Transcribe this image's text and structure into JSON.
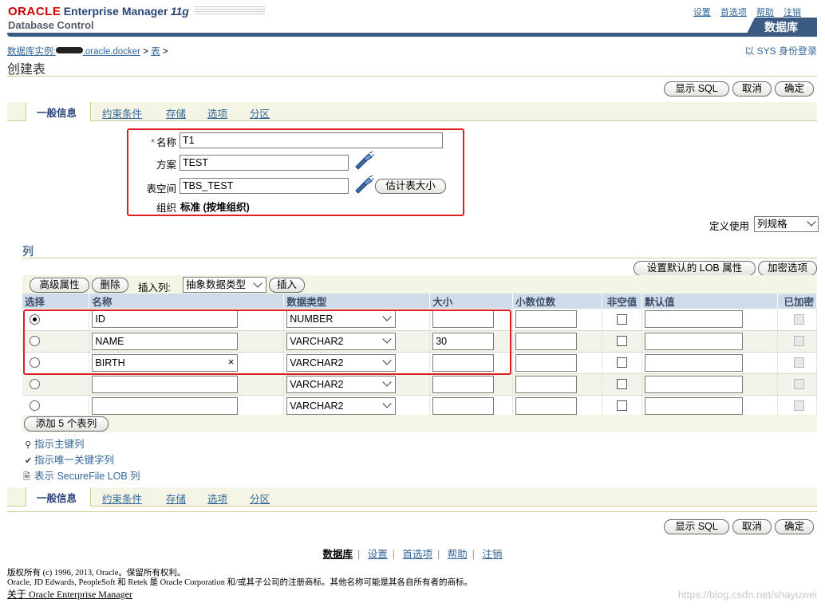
{
  "header": {
    "brand_oracle": "ORACLE",
    "brand_product": "Enterprise Manager",
    "brand_version": "11g",
    "brand_sub": "Database Control",
    "global_links": [
      "设置",
      "首选项",
      "帮助",
      "注销"
    ],
    "active_tab": "数据库"
  },
  "breadcrumb": {
    "instance_prefix": "数据库实例:",
    "instance_suffix": ".oracle.docker",
    "sep": ">",
    "table": "表",
    "tail": ">"
  },
  "login_info": "以 SYS 身份登录",
  "page_title": "创建表",
  "actions": {
    "show_sql": "显示 SQL",
    "cancel": "取消",
    "ok": "确定"
  },
  "subtabs": [
    "一般信息",
    "约束条件",
    "存储",
    "选项",
    "分区"
  ],
  "form": {
    "required_mark": "*",
    "name_label": "名称",
    "name_value": "T1",
    "schema_label": "方案",
    "schema_value": "TEST",
    "tablespace_label": "表空间",
    "tablespace_value": "TBS_TEST",
    "estimate_button": "估计表大小",
    "org_label": "组织",
    "org_value": "标准 (按堆组织)",
    "define_using_label": "定义使用",
    "define_using_value": "列规格"
  },
  "columns_section": {
    "title": "列",
    "lob_button": "设置默认的 LOB 属性",
    "encrypt_button": "加密选项",
    "advanced_button": "高级属性",
    "delete_button": "删除",
    "insert_label": "插入列:",
    "insert_type": "抽象数据类型",
    "insert_button": "插入",
    "headers": [
      "选择",
      "名称",
      "数据类型",
      "大小",
      "小数位数",
      "非空值",
      "默认值",
      "已加密"
    ],
    "rows": [
      {
        "selected": true,
        "name": "ID",
        "type": "NUMBER",
        "size": "",
        "scale": "",
        "not_null": false,
        "default": "",
        "clear": ""
      },
      {
        "selected": false,
        "name": "NAME",
        "type": "VARCHAR2",
        "size": "30",
        "scale": "",
        "not_null": false,
        "default": "",
        "clear": ""
      },
      {
        "selected": false,
        "name": "BIRTH",
        "type": "VARCHAR2",
        "size": "",
        "scale": "",
        "not_null": false,
        "default": "",
        "clear": "×"
      },
      {
        "selected": false,
        "name": "",
        "type": "VARCHAR2",
        "size": "",
        "scale": "",
        "not_null": false,
        "default": "",
        "clear": ""
      },
      {
        "selected": false,
        "name": "",
        "type": "VARCHAR2",
        "size": "",
        "scale": "",
        "not_null": false,
        "default": "",
        "clear": ""
      }
    ],
    "add_rows_button": "添加 5 个表列",
    "hints": [
      "指示主键列",
      "指示唯一关键字列",
      "表示 SecureFile LOB 列"
    ]
  },
  "footer": {
    "links": [
      "数据库",
      "设置",
      "首选项",
      "帮助",
      "注销"
    ],
    "copyright1": "版权所有 (c) 1996, 2013, Oracle。保留所有权利。",
    "copyright2": "Oracle, JD Edwards, PeopleSoft 和 Retek 是 Oracle Corporation 和/或其子公司的注册商标。其他名称可能是其各自所有者的商标。",
    "about": "关于 Oracle Enterprise Manager"
  },
  "watermark": "https://blog.csdn.net/shayuwei"
}
